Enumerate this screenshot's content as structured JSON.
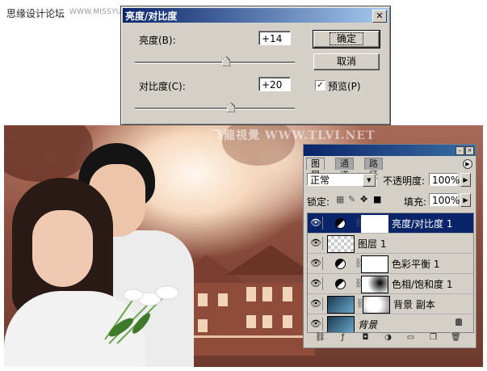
{
  "site": {
    "name_cn": "思缘设计论坛",
    "url": "WWW.MISSYUAN.COM"
  },
  "photo": {
    "watermark": "飞龍視覺 WWW.TLVI.NET"
  },
  "dialog": {
    "title": "亮度/对比度",
    "close_glyph": "✕",
    "brightness_label": "亮度(B):",
    "brightness_value": "+14",
    "contrast_label": "对比度(C):",
    "contrast_value": "+20",
    "brightness_level": 14,
    "contrast_level": 20,
    "ok_label": "确定",
    "cancel_label": "取消",
    "preview_label": "预览(P)",
    "preview_checked": true,
    "check_glyph": "✓"
  },
  "layers_panel": {
    "tabs": [
      {
        "label": "图层",
        "active": true
      },
      {
        "label": "通道",
        "active": false
      },
      {
        "label": "路径",
        "active": false
      }
    ],
    "blend_mode": "正常",
    "opacity_label": "不透明度:",
    "opacity_value": "100%",
    "lock_label": "锁定:",
    "fill_label": "填充:",
    "fill_value": "100%",
    "layers": [
      {
        "name": "亮度/对比度 1",
        "type": "adjustment",
        "selected": true
      },
      {
        "name": "图层 1",
        "type": "image",
        "selected": false
      },
      {
        "name": "色彩平衡 1",
        "type": "adjustment",
        "selected": false
      },
      {
        "name": "色相/饱和度 1",
        "type": "adjustment",
        "selected": false
      },
      {
        "name": "背景 副本",
        "type": "image",
        "selected": false
      },
      {
        "name": "背景",
        "type": "background",
        "selected": false,
        "locked": true
      }
    ],
    "icons": [
      "eye-icon",
      "link-icon",
      "lock-icon",
      "new-layer-icon",
      "trash-icon",
      "fx-icon",
      "mask-icon",
      "adjustment-icon",
      "folder-icon"
    ],
    "colors": {
      "selection": "#0a246a",
      "chrome": "#d4d0c8"
    }
  }
}
